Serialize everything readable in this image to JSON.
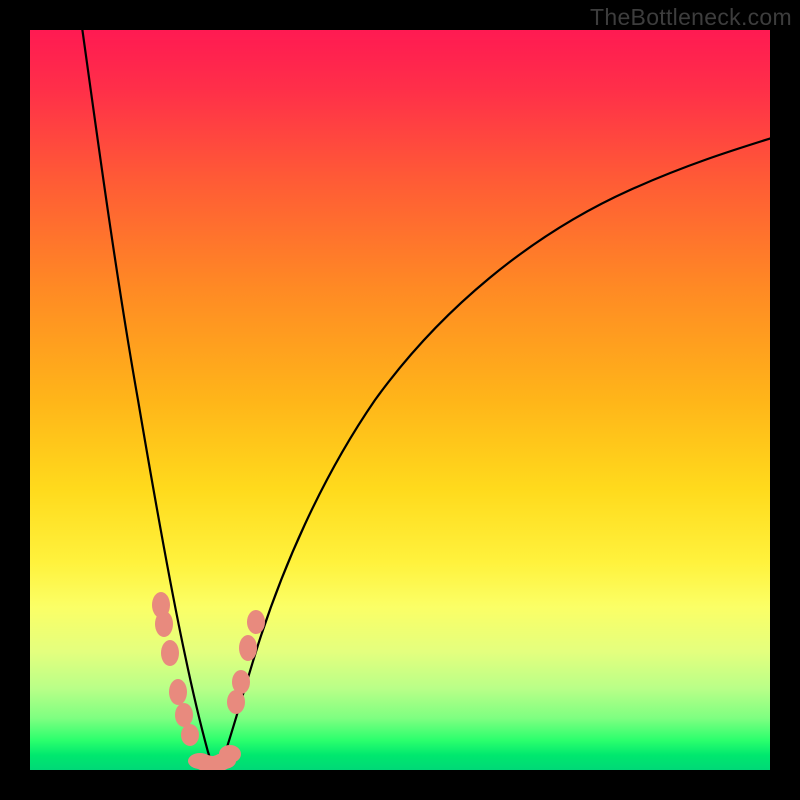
{
  "watermark": {
    "text": "TheBottleneck.com"
  },
  "colors": {
    "background": "#000000",
    "curve": "#000000",
    "dots": "#e88a7e",
    "gradient_stops": [
      "#ff1a52",
      "#ff2f49",
      "#ff5a36",
      "#ff8a24",
      "#ffb519",
      "#ffda1c",
      "#fff23d",
      "#fbff66",
      "#e4ff7e",
      "#b9ff88",
      "#7eff81",
      "#2bff6d",
      "#00e86e",
      "#00d877"
    ]
  },
  "chart_data": {
    "type": "line",
    "title": "",
    "xlabel": "",
    "ylabel": "",
    "xlim": [
      0,
      100
    ],
    "ylim": [
      0,
      100
    ],
    "note": "Axes and tick labels are not shown in the image; x and y are read as percent of the plot area with y=0 at bottom, y=100 at top. Values are estimated from pixel positions.",
    "series": [
      {
        "name": "left-branch",
        "x": [
          7.0,
          8.0,
          9.0,
          10.5,
          12.0,
          13.5,
          15.0,
          16.5,
          18.0,
          19.0,
          20.0,
          21.0,
          22.0,
          23.0,
          23.8
        ],
        "y": [
          100.0,
          90.0,
          80.0,
          68.0,
          55.0,
          44.0,
          34.0,
          25.0,
          18.0,
          13.0,
          9.0,
          6.0,
          3.5,
          1.8,
          1.0
        ]
      },
      {
        "name": "right-branch",
        "x": [
          25.5,
          26.5,
          27.5,
          29.0,
          31.0,
          34.0,
          38.0,
          43.0,
          49.0,
          56.0,
          64.0,
          73.0,
          83.0,
          92.0,
          100.0
        ],
        "y": [
          1.0,
          4.0,
          8.0,
          14.0,
          22.0,
          31.0,
          41.0,
          50.0,
          58.0,
          65.0,
          71.0,
          76.0,
          80.0,
          83.0,
          85.5
        ]
      }
    ],
    "points_left_branch": [
      {
        "x": 17.5,
        "y": 22.0
      },
      {
        "x": 17.9,
        "y": 19.5
      },
      {
        "x": 18.6,
        "y": 15.5
      },
      {
        "x": 19.8,
        "y": 10.0
      },
      {
        "x": 20.6,
        "y": 7.0
      },
      {
        "x": 21.4,
        "y": 4.5
      }
    ],
    "points_right_branch": [
      {
        "x": 27.6,
        "y": 9.0
      },
      {
        "x": 28.3,
        "y": 12.0
      },
      {
        "x": 29.3,
        "y": 16.5
      },
      {
        "x": 30.3,
        "y": 20.0
      }
    ],
    "points_bottom_cluster": [
      {
        "x": 22.8,
        "y": 1.2
      },
      {
        "x": 23.5,
        "y": 0.9
      },
      {
        "x": 24.3,
        "y": 0.8
      },
      {
        "x": 25.2,
        "y": 0.9
      },
      {
        "x": 26.0,
        "y": 1.3
      },
      {
        "x": 26.8,
        "y": 2.2
      }
    ]
  }
}
